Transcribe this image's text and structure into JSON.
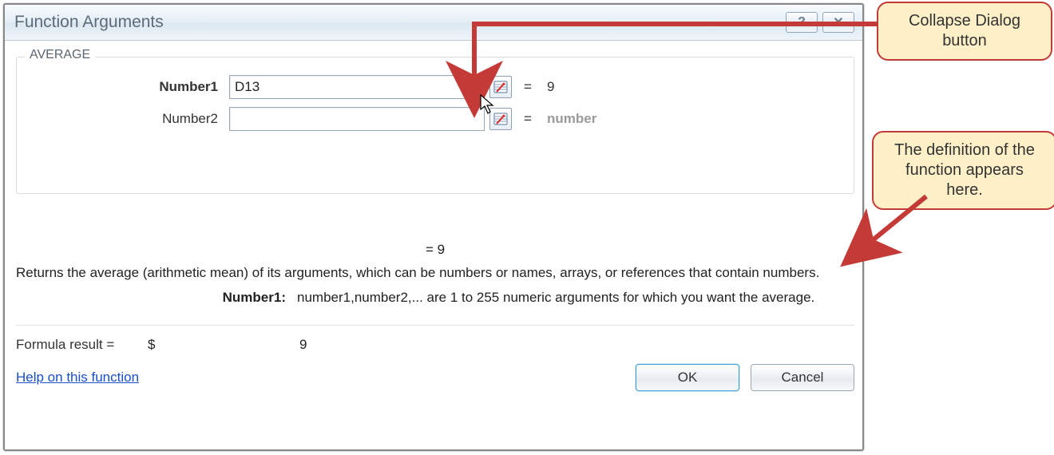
{
  "dialog": {
    "title": "Function Arguments",
    "help_glyph": "?",
    "close_glyph": "✕"
  },
  "group": {
    "legend": "AVERAGE",
    "rows": [
      {
        "label": "Number1",
        "bold": true,
        "value": "D13",
        "result": "9",
        "dim": false
      },
      {
        "label": "Number2",
        "bold": false,
        "value": "",
        "result": "number",
        "dim": true
      }
    ]
  },
  "center_eq": "=  9",
  "description": "Returns the average (arithmetic mean) of its arguments, which can be numbers or names, arrays, or references that contain numbers.",
  "arg_desc": {
    "key": "Number1:",
    "text": "number1,number2,... are 1 to 255 numeric arguments for which you want the average."
  },
  "formula": {
    "label": "Formula result =",
    "currency": "$",
    "value": "9"
  },
  "footer": {
    "help": "Help on this function",
    "ok": "OK",
    "cancel": "Cancel"
  },
  "callouts": {
    "top": "Collapse Dialog button",
    "mid": "The definition of the function appears here."
  }
}
